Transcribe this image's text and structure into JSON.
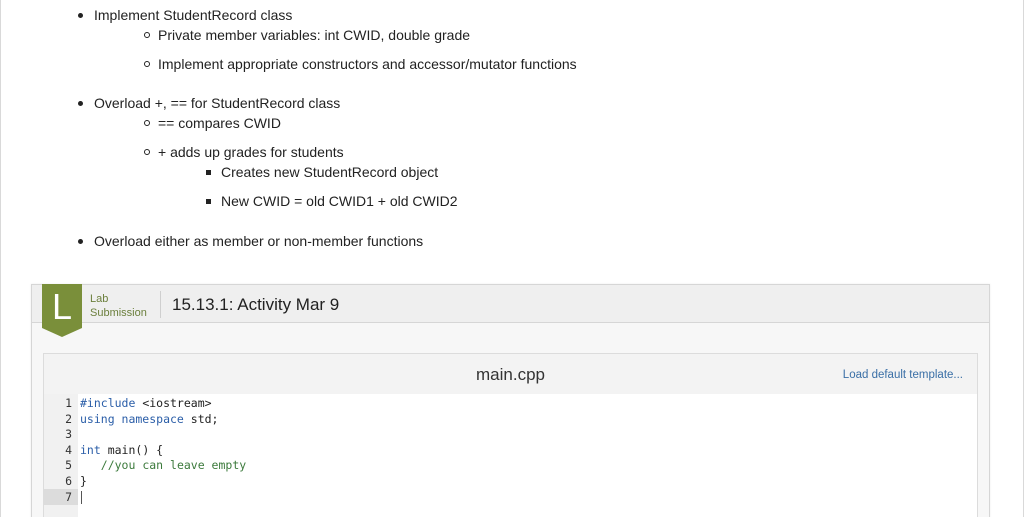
{
  "instructions": {
    "items": [
      {
        "level": 1,
        "text": "Implement StudentRecord class"
      },
      {
        "level": 2,
        "text": "Private member variables: int CWID, double grade"
      },
      {
        "level": 2,
        "text": "Implement appropriate constructors and accessor/mutator functions"
      },
      {
        "level": 1,
        "text": "Overload +, == for StudentRecord class"
      },
      {
        "level": 2,
        "text": "== compares CWID"
      },
      {
        "level": 2,
        "text": "+ adds up grades for students"
      },
      {
        "level": 3,
        "text": "Creates new StudentRecord object"
      },
      {
        "level": 3,
        "text": "New CWID = old CWID1 + old CWID2"
      },
      {
        "level": 1,
        "text": "Overload either as member or non-member functions"
      }
    ]
  },
  "lab": {
    "badge_letter": "L",
    "type_line1": "Lab",
    "type_line2": "Submission",
    "title": "15.13.1: Activity Mar 9",
    "accent_color": "#7a8f3a"
  },
  "editor": {
    "file_name": "main.cpp",
    "load_template_label": "Load default template...",
    "line_numbers": [
      "1",
      "2",
      "3",
      "4",
      "5",
      "6",
      "7"
    ],
    "active_line": 7,
    "code": {
      "l1_kw": "#include",
      "l1_rest": " <iostream>",
      "l2_kw": "using namespace",
      "l2_rest": " std;",
      "l4_kw": "int",
      "l4_rest": " main() {",
      "l5_indent": "   ",
      "l5_comment": "//you can leave empty",
      "l6": "}"
    }
  }
}
